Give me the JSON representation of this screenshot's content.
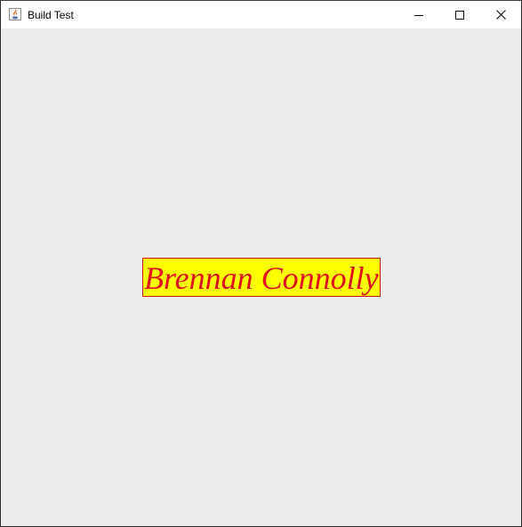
{
  "window": {
    "title": "Build Test",
    "controls": {
      "minimize_icon": "minimize-icon",
      "maximize_icon": "maximize-icon",
      "close_icon": "close-icon"
    }
  },
  "content": {
    "name_label": {
      "text": "Brennan Connolly",
      "text_color": "#e0101c",
      "background_color": "#ffff00",
      "border_color": "#d01010"
    },
    "background_color": "#ededed"
  }
}
